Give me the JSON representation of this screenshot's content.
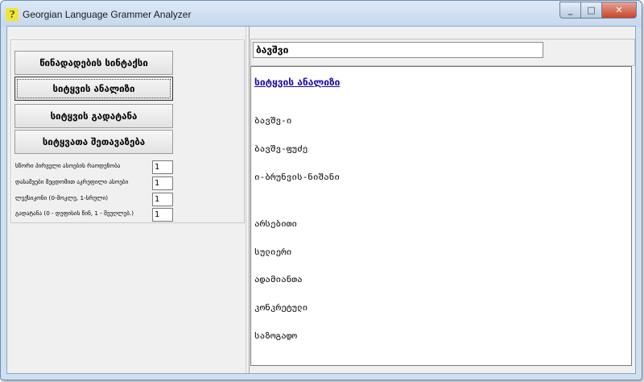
{
  "window": {
    "title": "Georgian Language Grammer Analyzer",
    "icon_char": "?"
  },
  "controls": {
    "minimize": "_",
    "maximize": "□",
    "close": "✕"
  },
  "buttons": [
    "წინადადების სინტაქსი",
    "სიტყვის ანალიზი",
    "სიტყვის გადატანა",
    "სიტყვათა შეთავაზება"
  ],
  "params": [
    {
      "label": "სწორი პირველი ასოების რაოდენობა",
      "value": "1"
    },
    {
      "label": "დასაშვები შეცდომით აკრეფილი ასოები",
      "value": "1"
    },
    {
      "label": "ლექსიკონი (0-მოკლე, 1-სრული)",
      "value": "1"
    },
    {
      "label": "გადატანა (0 - დეფისის წინ, 1 - შეუღლებ.)",
      "value": "1"
    }
  ],
  "word_input": {
    "value": "ბავშვი"
  },
  "output": {
    "heading": "სიტყვის ანალიზი",
    "lines": [
      "ბავშვ-ი",
      "ბავშვ-ფუძე",
      "ი-ბრუნვის-ნიშანი",
      "",
      "არსებითი",
      "სულიერი",
      "ადამიანთა",
      "კონკრეტული",
      "საზოგადო"
    ]
  }
}
